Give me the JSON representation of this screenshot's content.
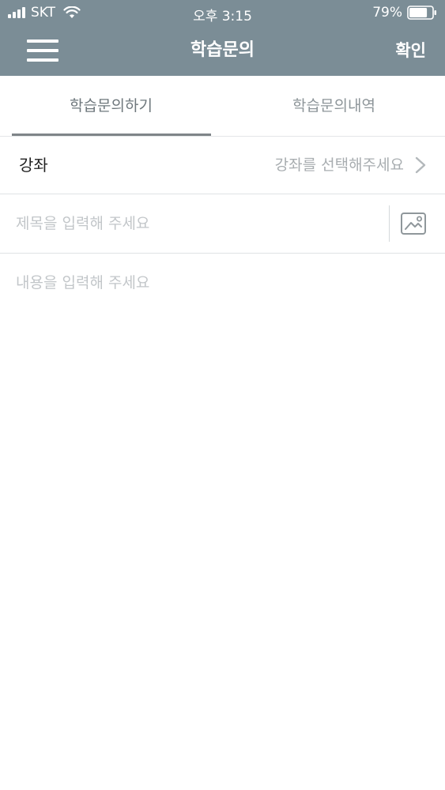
{
  "status_bar": {
    "carrier": "SKT",
    "time": "오후 3:15",
    "battery": "79%",
    "battery_level": 0.79,
    "signal_icon": "signal-bars-icon",
    "wifi_icon": "wifi-icon",
    "battery_icon": "battery-icon"
  },
  "nav": {
    "title": "학습문의",
    "confirm_label": "확인",
    "menu_icon": "hamburger-menu-icon"
  },
  "tabs": [
    {
      "label": "학습문의하기",
      "active": true
    },
    {
      "label": "학습문의내역",
      "active": false
    }
  ],
  "form": {
    "course_label": "강좌",
    "course_value": "강좌를 선택해주세요",
    "title_placeholder": "제목을 입력해 주세요",
    "title_value": "",
    "content_placeholder": "내용을 입력해 주세요",
    "content_value": "",
    "attach_icon": "image-attach-icon"
  },
  "colors": {
    "header_bg": "#7b8d96",
    "header_text": "#ffffff",
    "tab_active_indicator": "#7f8588",
    "placeholder": "#c2c6c9"
  }
}
